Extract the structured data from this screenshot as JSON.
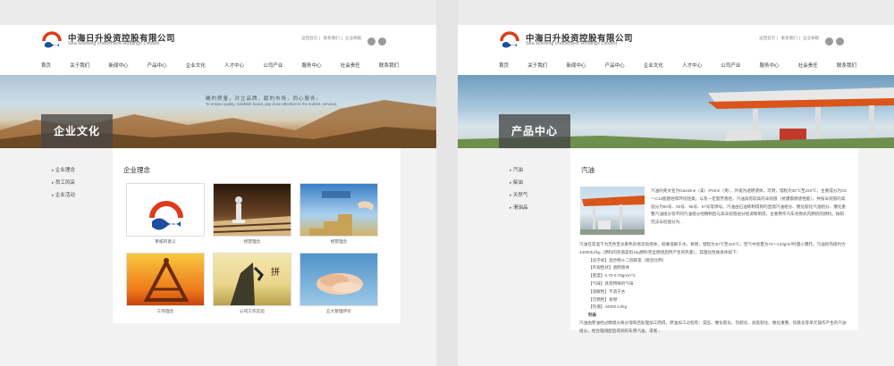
{
  "company": {
    "name_cn": "中海日升投资控股有限公司",
    "name_en": "Sea Risheng Investment Holdings Limited"
  },
  "toplinks": [
    "返回首页",
    "联系我们",
    "企业邮箱"
  ],
  "nav": [
    "首页",
    "关于我们",
    "新闻中心",
    "产品中心",
    "企业文化",
    "人才中心",
    "公司产业",
    "服务中心",
    "社会责任",
    "联系我们"
  ],
  "left": {
    "banner_title": "企业文化",
    "slogan": "确的质量，对立品牌，献的市场，同心服务。",
    "slogan_en": "To ensure quality, establish brand, pay close attention to the market, services",
    "side_items": [
      "企业理念",
      "员工风采",
      "企业活动"
    ],
    "section_title": "企业理念",
    "cards": [
      "审核的意义",
      "经营理念",
      "经营理念",
      "工作理念",
      "公司工作实验",
      "五大管理评价"
    ],
    "colors": {
      "thumb1": "#ffffff",
      "thumb2": "#5a3a1f",
      "thumb3": "#6aa8d8",
      "thumb4": "#e8a030",
      "thumb5": "#d9c070",
      "thumb6": "#5d9fc8"
    }
  },
  "right": {
    "banner_title": "产品中心",
    "side_items": [
      "汽油",
      "柴油",
      "天然气",
      "滑油品"
    ],
    "section_title": "汽油",
    "intro": "汽油的英文名为Gasoline（美）/Petrol（英），外观为透明液体，可燃，馏程为30℃至220℃，主要成分为C5～C12脂肪烃和环烷烃类，以及一定量芳香烃，汽油具有较高的辛烷值（抗爆震燃烧性能），并按辛烷值的高低分为90号、93号、95号、97号等牌号。汽油由石油炼制得到的直馏汽油组分、催化裂化汽油组分、催化重整汽油组分等不同汽油组分经精制后与高辛烷值组分经调和制得，主要用作汽车点燃式内燃机的燃料。按研究法辛烷值分为...",
    "para2": "汽油在常温下为无色至淡黄色的易流动液体，很难溶解于水，易燃，馏程为30℃至220℃，空气中含量为74～123g/m³时遇火爆炸。汽油的热值约为44000kJ/kg（燃料的热值是指1kg燃料完全燃烧后所产生的热量）。其理化性质具体如下：",
    "specs": [
      "【化学式】混合物十二烷碳氢（醇混比例）",
      "【外观性状】透明液体",
      "【密度】0.70-0.78g/cm^3",
      "【气味】具有特殊的气味",
      "【溶解性】不溶于水",
      "【可燃性】易燃",
      "【热值】44000 kJ/kg"
    ],
    "spec_title": "制备",
    "para3": "汽油由原油经过精馏分离分馏和后处理加工而得，原油加工过程有：常压、催化裂化、热裂化、加氢裂化、催化重整、烷基化等单元操作产生的汽油组分，经合理调配后得到的车用汽油，或者..."
  }
}
